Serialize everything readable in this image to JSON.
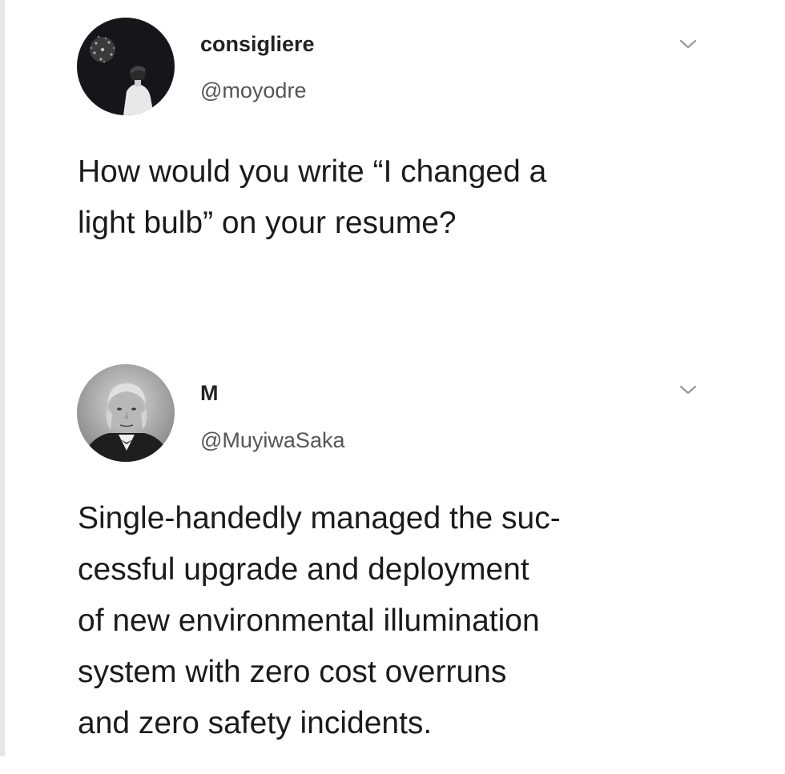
{
  "tweets": [
    {
      "display_name": "consigliere",
      "handle": "@moyodre",
      "avatar_icon": "fireworks-portrait-avatar",
      "menu_icon": "chevron-down-icon",
      "text_lines": [
        "How would you write “I changed a",
        "light bulb” on your resume?"
      ]
    },
    {
      "display_name": "M",
      "handle": "@MuyiwaSaka",
      "avatar_icon": "vintage-portrait-avatar",
      "menu_icon": "chevron-down-icon",
      "text_lines": [
        "Single-handedly managed the suc-",
        "cessful upgrade and deployment",
        "of new environmental illumination",
        "system with zero cost overruns",
        "and zero safety incidents."
      ]
    }
  ],
  "colors": {
    "background": "#ffffff",
    "text": "#1b1b1b",
    "handle": "#555555",
    "chevron": "#9a9a9a"
  }
}
